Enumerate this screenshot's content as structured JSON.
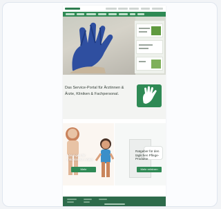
{
  "intro": {
    "text": "Das Service-Portal für Ärztinnen & Ärzte, Kliniken & Fachpersonal."
  },
  "products": {
    "left_title": "Lösungen für Inkontinenz-Artikel",
    "left_cta": "Mehr",
    "right_title": "Ratgeber für den täglichen Pflege-Produkte",
    "right_cta": "Mehr erfahren"
  },
  "colors": {
    "brand_green": "#2f8a55",
    "footer_green": "#2e6b4b"
  },
  "icons": [
    "hand-icon",
    "logo-icon"
  ]
}
